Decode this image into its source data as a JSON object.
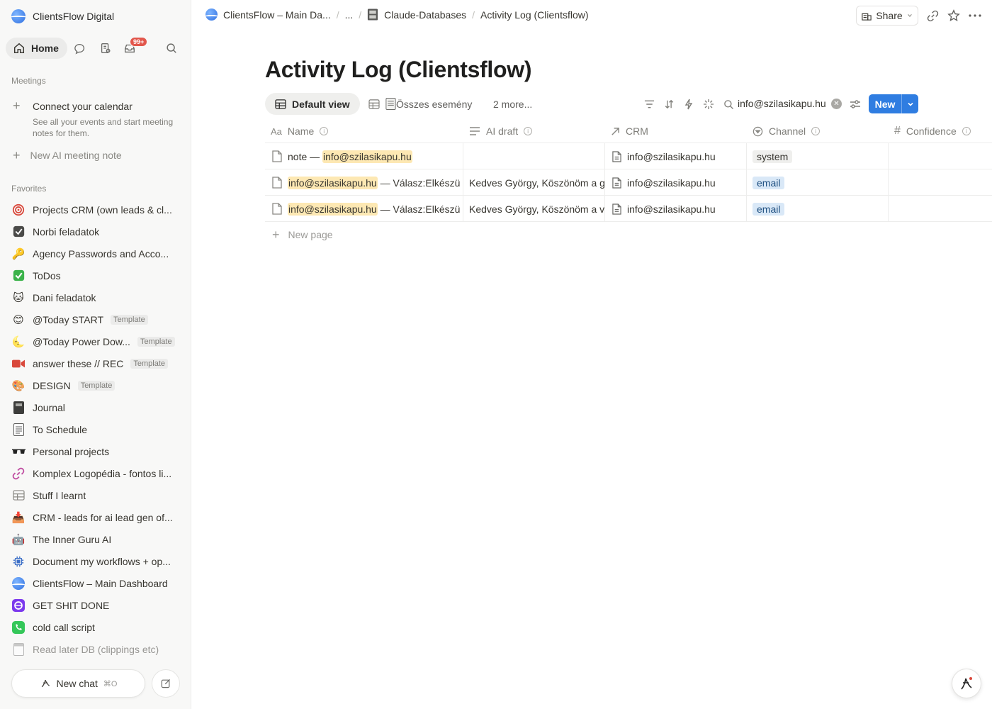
{
  "sidebar": {
    "workspace": "ClientsFlow Digital",
    "home_label": "Home",
    "inbox_badge": "99+",
    "meetings_label": "Meetings",
    "connect_title": "Connect your calendar",
    "connect_desc": "See all your events and start meeting notes for them.",
    "new_ai_note": "New AI meeting note",
    "favorites_label": "Favorites",
    "favorites": [
      {
        "label": "Projects CRM (own leads & cl...",
        "icon": "target-icon"
      },
      {
        "label": "Norbi feladatok",
        "icon": "checkbox-icon"
      },
      {
        "label": "Agency Passwords and Acco...",
        "icon": "key-icon"
      },
      {
        "label": "ToDos",
        "icon": "green-check-icon"
      },
      {
        "label": "Dani feladatok",
        "icon": "cat-icon"
      },
      {
        "label": "@Today START",
        "icon": "smile-icon",
        "tag": "Template"
      },
      {
        "label": "@Today Power Dow...",
        "icon": "moon-icon",
        "tag": "Template"
      },
      {
        "label": "answer these // REC",
        "icon": "video-icon",
        "tag": "Template"
      },
      {
        "label": "DESIGN",
        "icon": "palette-icon",
        "tag": "Template"
      },
      {
        "label": "Journal",
        "icon": "notebook-icon"
      },
      {
        "label": "To Schedule",
        "icon": "ledger-icon"
      },
      {
        "label": "Personal projects",
        "icon": "glasses-icon"
      },
      {
        "label": "Komplex Logopédia - fontos li...",
        "icon": "link-icon"
      },
      {
        "label": "Stuff I learnt",
        "icon": "table-icon"
      },
      {
        "label": "CRM - leads for ai lead gen of...",
        "icon": "inbox-tray-icon"
      },
      {
        "label": "The Inner Guru AI",
        "icon": "robot-icon"
      },
      {
        "label": "Document my workflows + op...",
        "icon": "chip-icon"
      },
      {
        "label": "ClientsFlow – Main Dashboard",
        "icon": "globe-icon"
      },
      {
        "label": "GET SHIT DONE",
        "icon": "purple-orb-icon"
      },
      {
        "label": "cold call script",
        "icon": "phone-icon"
      },
      {
        "label": "Read later DB (clippings etc)",
        "icon": "calendar-icon"
      }
    ],
    "new_chat": "New chat",
    "new_chat_kbd": "⌘O"
  },
  "topbar": {
    "crumb1": "ClientsFlow – Main Da...",
    "crumb2": "...",
    "crumb3": "Claude-Databases",
    "crumb4": "Activity Log (Clientsflow)",
    "share": "Share"
  },
  "page": {
    "title": "Activity Log (Clientsflow)",
    "view_default": "Default view",
    "view_all": "Összes esemény",
    "view_more": "2 more...",
    "search_value": "info@szilasikapu.hu",
    "new_button": "New",
    "new_page": "New page"
  },
  "table": {
    "columns": [
      "Name",
      "AI draft",
      "CRM",
      "Channel",
      "Confidence"
    ],
    "rows": [
      {
        "name_prefix": "note — ",
        "name_hl": "info@szilasikapu.hu",
        "name_suffix": "",
        "draft": "",
        "crm": "info@szilasikapu.hu",
        "channel": "system"
      },
      {
        "name_prefix": "",
        "name_hl": "info@szilasikapu.hu",
        "name_suffix": " — Válasz:Elkészü",
        "draft": "Kedves György, Köszönöm a g",
        "crm": "info@szilasikapu.hu",
        "channel": "email"
      },
      {
        "name_prefix": "",
        "name_hl": "info@szilasikapu.hu",
        "name_suffix": " — Válasz:Elkészü",
        "draft": "Kedves György, Köszönöm a v",
        "crm": "info@szilasikapu.hu",
        "channel": "email"
      }
    ]
  }
}
